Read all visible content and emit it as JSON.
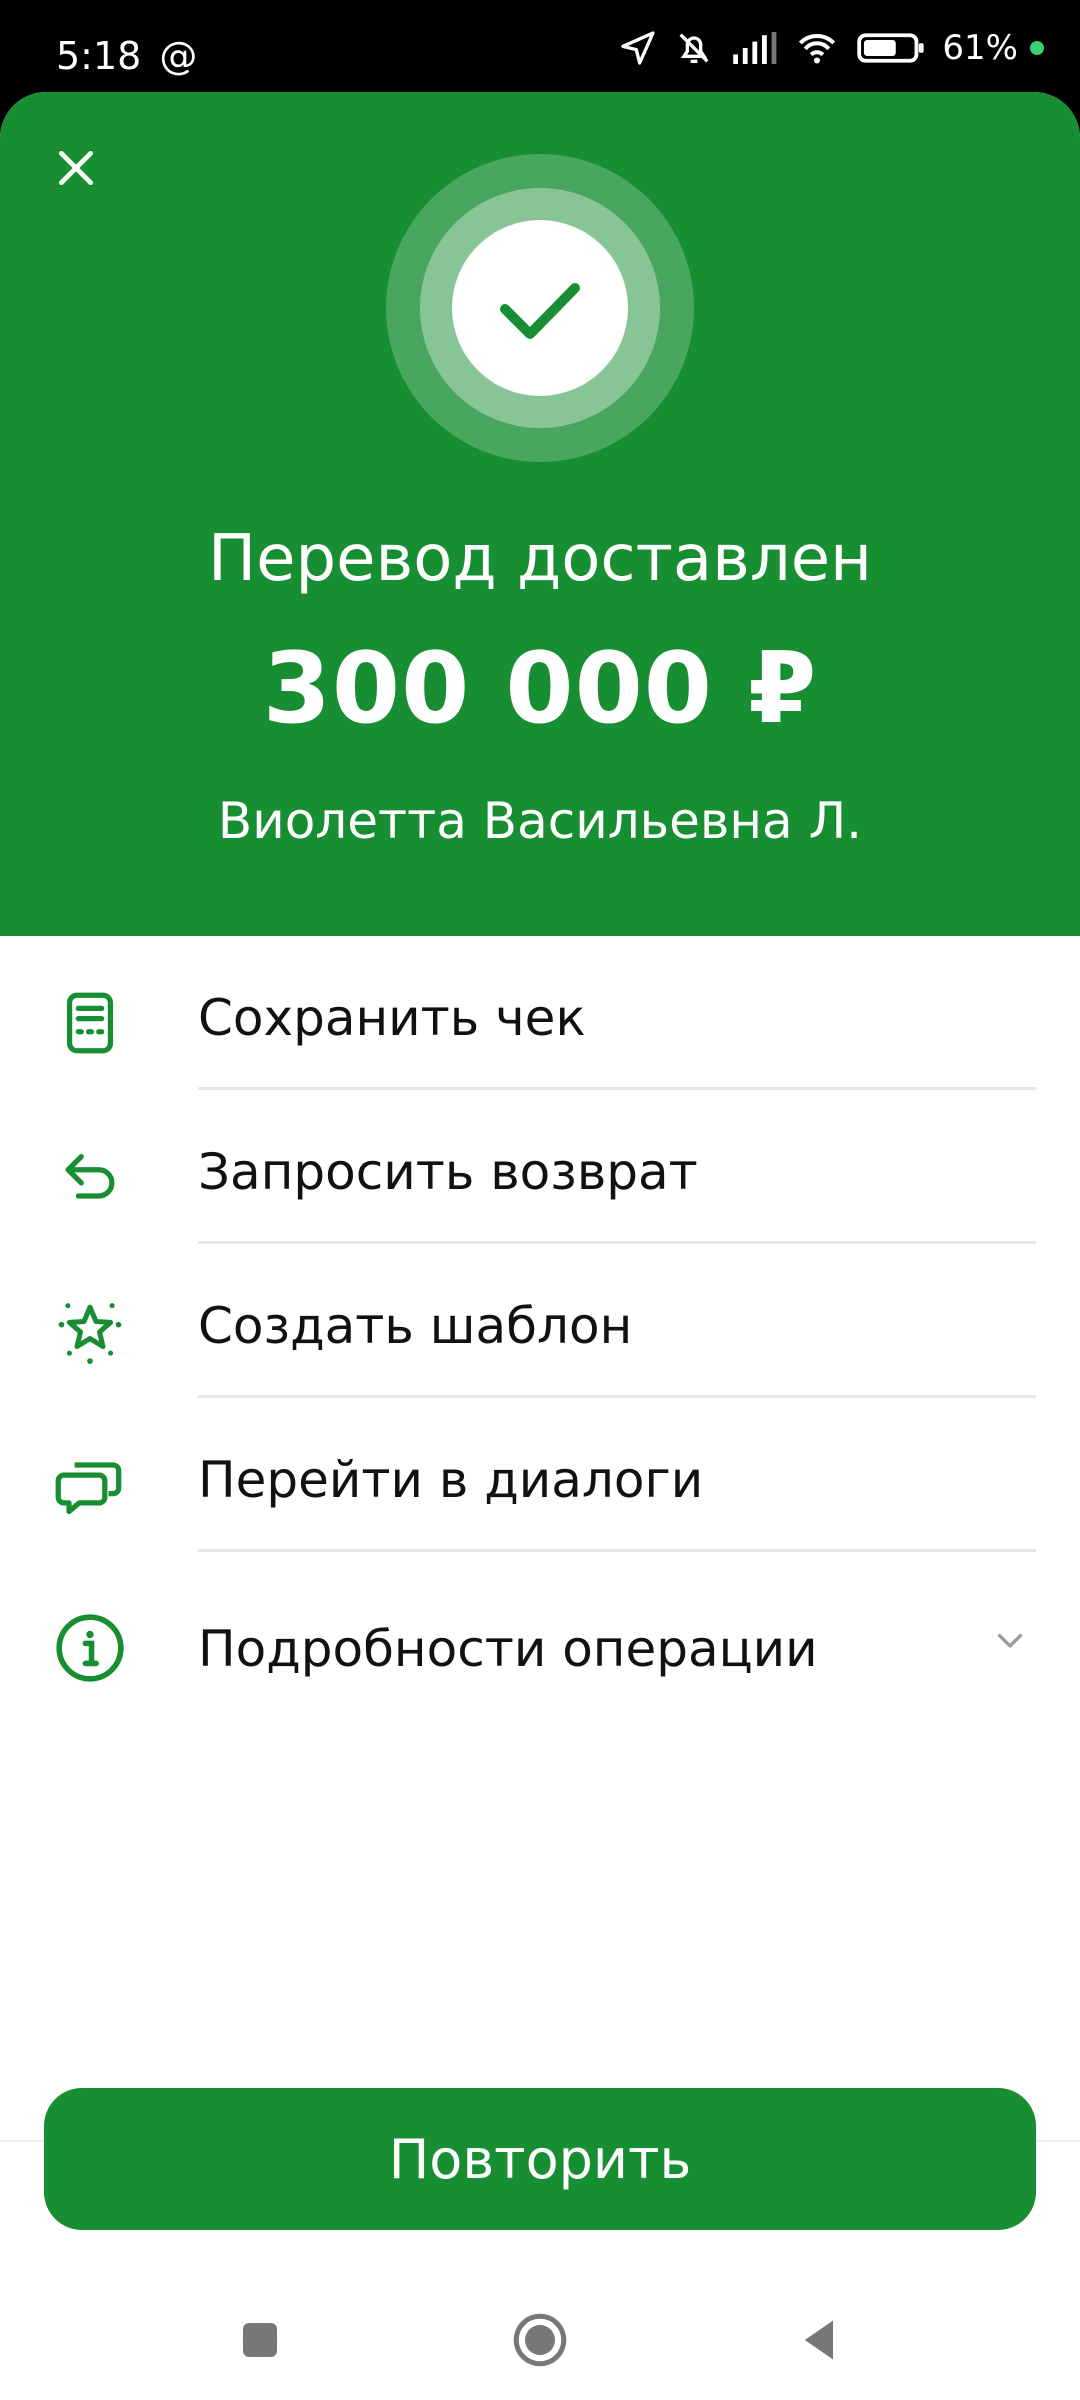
{
  "status_bar": {
    "time": "5:18",
    "at_symbol": "@",
    "battery_percent": "61%",
    "icons": [
      "location-arrow-icon",
      "bell-muted-icon",
      "signal-icon",
      "wifi-icon",
      "battery-icon",
      "charging-dot-icon"
    ]
  },
  "header": {
    "close_icon": "close-icon",
    "success_icon": "checkmark-icon",
    "title": "Перевод доставлен",
    "amount": "300 000 ₽",
    "recipient": "Виолетта Васильевна Л."
  },
  "actions": [
    {
      "label": "Сохранить чек",
      "icon": "receipt-icon"
    },
    {
      "label": "Запросить возврат",
      "icon": "return-arrow-icon"
    },
    {
      "label": "Создать шаблон",
      "icon": "star-sparkle-icon"
    },
    {
      "label": "Перейти в диалоги",
      "icon": "chat-bubbles-icon"
    },
    {
      "label": "Подробности операции",
      "icon": "info-icon",
      "chevron": "chevron-down-icon"
    }
  ],
  "primary_button": {
    "label": "Повторить"
  },
  "nav": {
    "icons": [
      "recents-square-icon",
      "home-circle-icon",
      "back-triangle-icon"
    ]
  },
  "colors": {
    "brand_green": "#178E31",
    "divider": "#e6e6e6",
    "text": "#111111"
  }
}
